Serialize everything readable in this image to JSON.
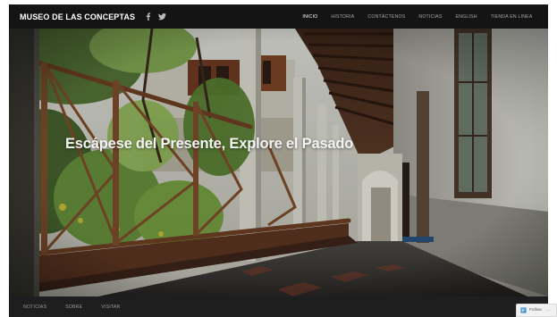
{
  "header": {
    "brand": "MUSEO DE LAS CONCEPTAS",
    "social": [
      {
        "icon": "facebook-icon",
        "glyph": "f"
      },
      {
        "icon": "twitter-icon"
      }
    ],
    "nav": [
      {
        "label": "INICIO",
        "active": true
      },
      {
        "label": "HISTORIA",
        "active": false
      },
      {
        "label": "CONTÁCTENOS",
        "active": false
      },
      {
        "label": "NOTICIAS",
        "active": false
      },
      {
        "label": "ENGLISH",
        "active": false
      },
      {
        "label": "TIENDA EN LINEA",
        "active": false
      }
    ]
  },
  "hero": {
    "title": "Escápese del Presente, Explore el Pasado"
  },
  "footer": {
    "nav": [
      {
        "label": "NOTICIAS"
      },
      {
        "label": "SOBRE"
      },
      {
        "label": "VISITAR"
      }
    ]
  },
  "follow_widget": {
    "label": "Follow",
    "more": "···",
    "icon": "wordpress-follow-icon"
  },
  "colors": {
    "header_bg": "#141414",
    "footer_bg": "#1e1e1e",
    "nav_active": "#ffffff",
    "nav_inactive": "#a7a7a7"
  }
}
